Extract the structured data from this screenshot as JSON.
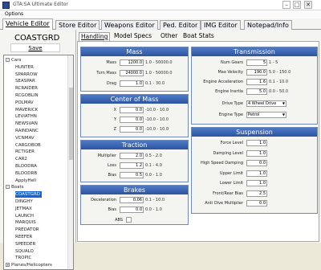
{
  "window": {
    "title": "GTA:SA Ultimate Editor",
    "minimize": "–",
    "maximize": "□",
    "close": "✕"
  },
  "menu": {
    "options": "Options"
  },
  "main_tabs": [
    "Vehicle Editor",
    "Store Editor",
    "Weapons Editor",
    "Ped. Editor",
    "IMG Editor",
    "Notepad/Info"
  ],
  "sidebar": {
    "vehicle_name": "COASTGRD",
    "save_label": "Save",
    "tree": [
      {
        "label": "Cars",
        "level": 0,
        "expander": "-"
      },
      {
        "label": "HUNTER",
        "level": 1
      },
      {
        "label": "SPARROW",
        "level": 1
      },
      {
        "label": "SEASPAR",
        "level": 1
      },
      {
        "label": "RCRAIDER",
        "level": 1
      },
      {
        "label": "RCGOBLIN",
        "level": 1
      },
      {
        "label": "POLMAV",
        "level": 1
      },
      {
        "label": "MAVERICK",
        "level": 1
      },
      {
        "label": "LEVIATHN",
        "level": 1
      },
      {
        "label": "NEWSVAN",
        "level": 1
      },
      {
        "label": "RAINDANC",
        "level": 1
      },
      {
        "label": "VCNMAV",
        "level": 1
      },
      {
        "label": "CARGOBOB",
        "level": 1
      },
      {
        "label": "RCTIGER",
        "level": 1
      },
      {
        "label": "CAR2",
        "level": 1
      },
      {
        "label": "BLOODRA",
        "level": 1
      },
      {
        "label": "BLOODRB",
        "level": 1
      },
      {
        "label": "ApplyHeli",
        "level": 1
      },
      {
        "label": "Boats",
        "level": 0,
        "expander": "-"
      },
      {
        "label": "COASTGRD",
        "level": 1,
        "selected": true
      },
      {
        "label": "DINGHY",
        "level": 1
      },
      {
        "label": "JETMAX",
        "level": 1
      },
      {
        "label": "LAUNCH",
        "level": 1
      },
      {
        "label": "MARQUIS",
        "level": 1
      },
      {
        "label": "PREDATOR",
        "level": 1
      },
      {
        "label": "REEFER",
        "level": 1
      },
      {
        "label": "SPEEDER",
        "level": 1
      },
      {
        "label": "SQUALO",
        "level": 1
      },
      {
        "label": "TROPIC",
        "level": 1
      },
      {
        "label": "Planes/Helicopters",
        "level": 0,
        "expander": "+"
      }
    ]
  },
  "sub_tabs": [
    "Handling",
    "Model Specs",
    "Other",
    "Boat Stats"
  ],
  "mass": {
    "title": "Mass",
    "fields": [
      {
        "label": "Mass",
        "value": "1200.0",
        "unit": "1.0 - 50000.0"
      },
      {
        "label": "Turn Mass",
        "value": "24000.0",
        "unit": "1.0 - 50000.0"
      },
      {
        "label": "Drag",
        "value": "1.0",
        "unit": "0.1 - 30.0"
      }
    ]
  },
  "center_of_mass": {
    "title": "Center of Mass",
    "fields": [
      {
        "label": "X",
        "value": "0.0",
        "unit": "-10.0 - 10.0"
      },
      {
        "label": "Y",
        "value": "0.0",
        "unit": "-10.0 - 10.0"
      },
      {
        "label": "Z",
        "value": "0.0",
        "unit": "-10.0 - 10.0"
      }
    ]
  },
  "traction": {
    "title": "Traction",
    "fields": [
      {
        "label": "Multiplier",
        "value": "2.0",
        "unit": "0.5 - 2.0"
      },
      {
        "label": "Loss",
        "value": "1.2",
        "unit": "0.1 - 4.0"
      },
      {
        "label": "Bias",
        "value": "0.5",
        "unit": "0.0 - 1.0"
      }
    ]
  },
  "brakes": {
    "title": "Brakes",
    "fields": [
      {
        "label": "Deceleration",
        "value": "0.06",
        "unit": "0.1 - 10.0"
      },
      {
        "label": "Bias",
        "value": "0.0",
        "unit": "0.0 - 1.0"
      }
    ],
    "abs_label": "ABS"
  },
  "transmission": {
    "title": "Transmission",
    "fields": [
      {
        "label": "Num Gears",
        "value": "5",
        "unit": "1 - 5"
      },
      {
        "label": "Max Velocity",
        "value": "190.0",
        "unit": "5.0 - 150.0"
      },
      {
        "label": "Engine Acceleration",
        "value": "1.6",
        "unit": "0.1 - 10.0"
      },
      {
        "label": "Engine Inertia",
        "value": "5.0",
        "unit": "0.0 - 50.0"
      }
    ],
    "drive_type": {
      "label": "Drive Type",
      "value": "4 Wheel Drive"
    },
    "engine_type": {
      "label": "Engine Type",
      "value": "Petrol"
    }
  },
  "suspension": {
    "title": "Suspension",
    "fields": [
      {
        "label": "Force Level",
        "value": "1.0",
        "unit": ""
      },
      {
        "label": "Damping Level",
        "value": "1.0",
        "unit": ""
      },
      {
        "label": "High Speed Damping",
        "value": "0.0",
        "unit": ""
      },
      {
        "label": "Upper Limit",
        "value": "1.0",
        "unit": ""
      },
      {
        "label": "Lower Limit",
        "value": "1.0",
        "unit": ""
      },
      {
        "label": "Front/Rear Bias",
        "value": "2.5",
        "unit": ""
      },
      {
        "label": "Anti Dive Multiplier",
        "value": "0.0",
        "unit": ""
      }
    ]
  }
}
